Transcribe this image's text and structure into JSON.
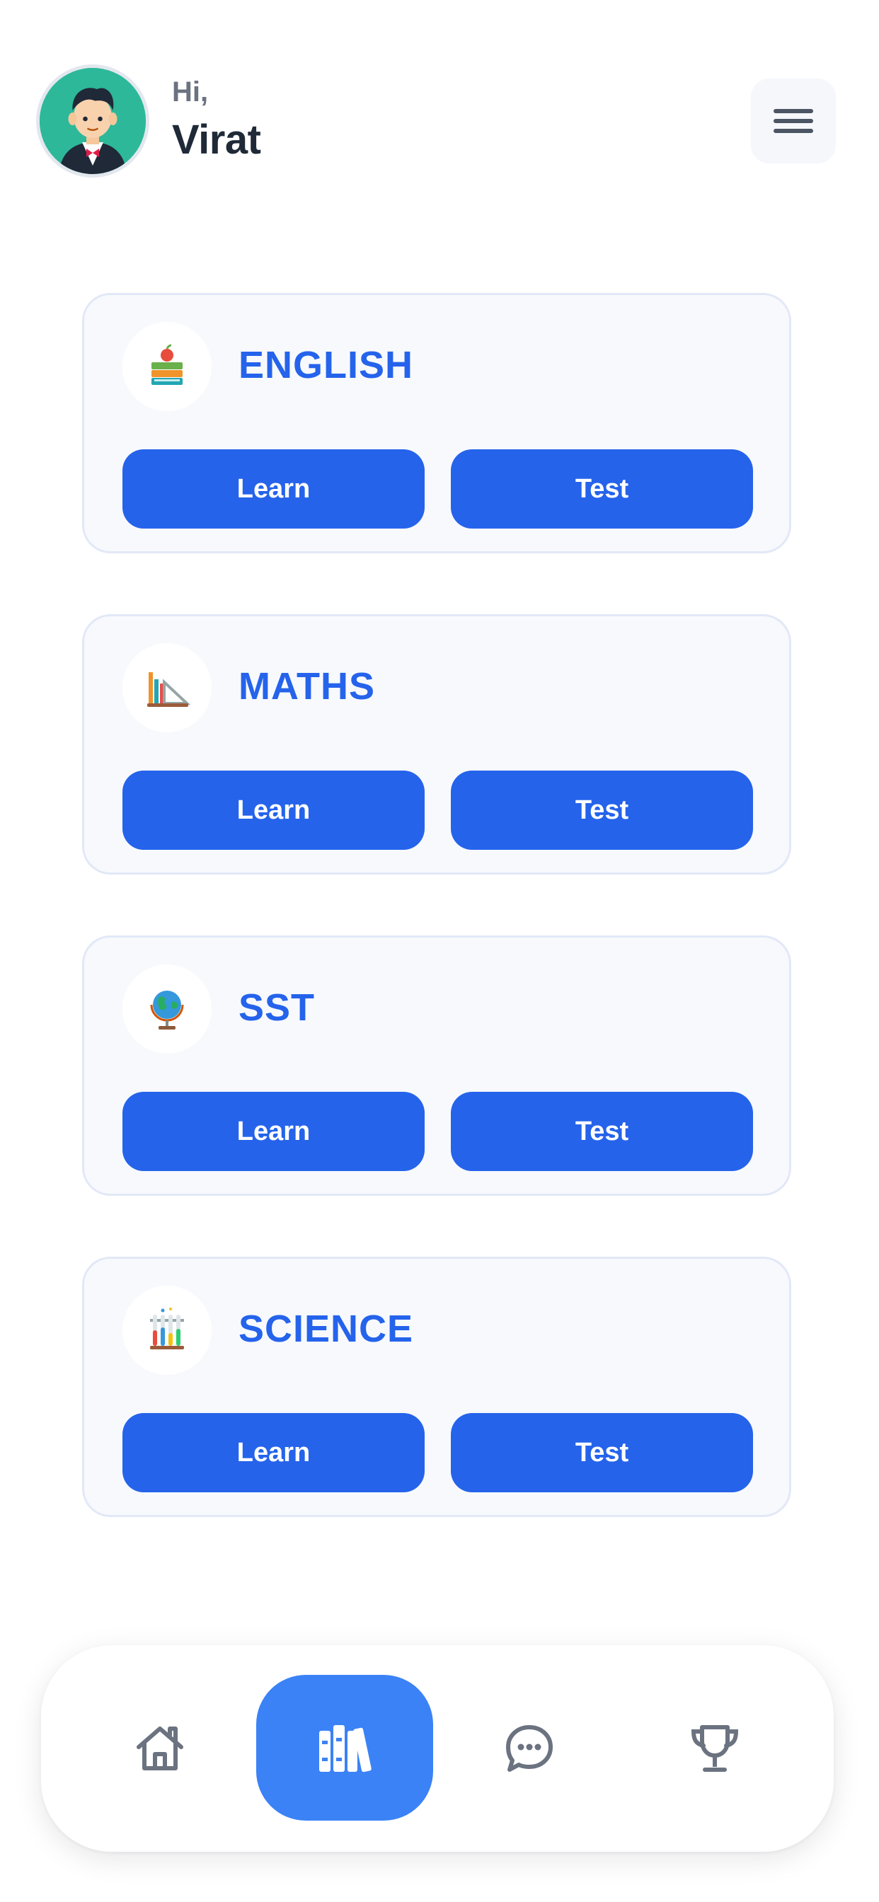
{
  "header": {
    "greeting": "Hi,",
    "user_name": "Virat"
  },
  "subjects": [
    {
      "title": "ENGLISH",
      "icon": "books-apple-icon",
      "learn_label": "Learn",
      "test_label": "Test"
    },
    {
      "title": "MATHS",
      "icon": "ruler-chart-icon",
      "learn_label": "Learn",
      "test_label": "Test"
    },
    {
      "title": "SST",
      "icon": "globe-icon",
      "learn_label": "Learn",
      "test_label": "Test"
    },
    {
      "title": "SCIENCE",
      "icon": "test-tubes-icon",
      "learn_label": "Learn",
      "test_label": "Test"
    }
  ],
  "bottom_nav": {
    "items": [
      "home-icon",
      "library-icon",
      "chat-icon",
      "trophy-icon"
    ],
    "active": "library-icon"
  },
  "colors": {
    "accent": "#2563eb",
    "nav_active": "#3b82f6",
    "card_bg": "#f7f9fd",
    "card_border": "#e2e8f7",
    "avatar_bg": "#2db89a"
  }
}
